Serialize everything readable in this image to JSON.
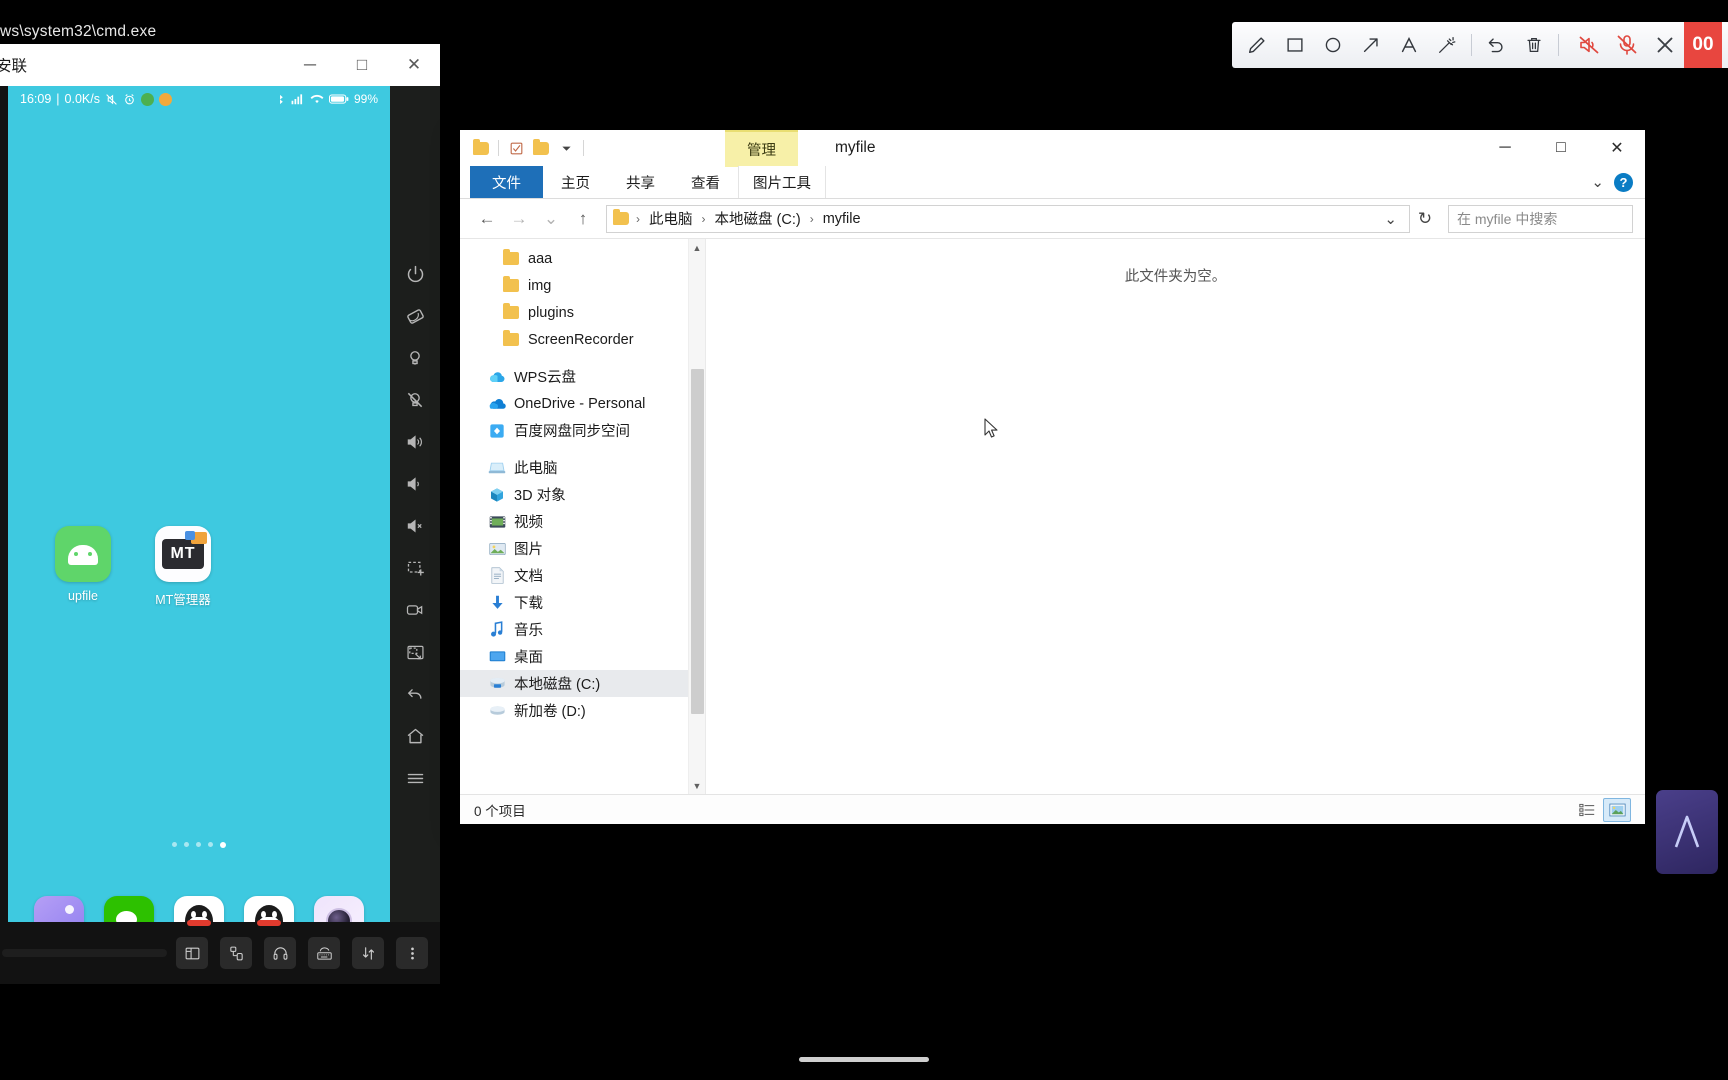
{
  "annotation_toolbar": {
    "tools": [
      {
        "name": "pencil-icon",
        "label": "铅笔"
      },
      {
        "name": "rectangle-icon",
        "label": "矩形"
      },
      {
        "name": "ellipse-icon",
        "label": "椭圆"
      },
      {
        "name": "arrow-icon",
        "label": "箭头"
      },
      {
        "name": "text-icon",
        "label": "A"
      },
      {
        "name": "magic-wand-icon",
        "label": "魔术棒"
      }
    ],
    "actions": [
      {
        "name": "undo-icon",
        "label": "撤销"
      },
      {
        "name": "delete-icon",
        "label": "删除"
      }
    ],
    "right_actions": [
      {
        "name": "speaker-muted-icon",
        "label": "静音"
      },
      {
        "name": "mic-muted-icon",
        "label": "麦克风静音"
      },
      {
        "name": "close-icon",
        "label": "关闭"
      }
    ],
    "record_badge": "00",
    "accent_red": "#e8463f"
  },
  "cmd_window": {
    "title": "ws\\system32\\cmd.exe"
  },
  "mirror_window": {
    "title": "安联",
    "window_buttons": [
      {
        "name": "minimize-button",
        "glyph": "─"
      },
      {
        "name": "maximize-button",
        "glyph": "□"
      },
      {
        "name": "close-button",
        "glyph": "✕"
      }
    ],
    "status_bar": {
      "time": "16:09",
      "network_speed": "0.0K/s",
      "battery": "99%"
    },
    "apps": [
      {
        "name": "upfile",
        "label": "upfile"
      },
      {
        "name": "mt-manager",
        "label": "MT管理器"
      }
    ],
    "dock": [
      {
        "name": "gallery-app",
        "label": "图库"
      },
      {
        "name": "wechat-app",
        "label": "微信"
      },
      {
        "name": "qq-app",
        "label": "QQ"
      },
      {
        "name": "qq-app-2",
        "label": "QQ"
      },
      {
        "name": "camera-app",
        "label": "相机"
      }
    ],
    "page_dots": 5,
    "active_dot": 5,
    "side_toolbar": [
      {
        "name": "power-icon",
        "label": "电源"
      },
      {
        "name": "rotate-screen-icon",
        "label": "旋转屏幕"
      },
      {
        "name": "light-on-icon",
        "label": "亮屏"
      },
      {
        "name": "light-off-icon",
        "label": "熄屏"
      },
      {
        "name": "volume-up-icon",
        "label": "音量加"
      },
      {
        "name": "volume-down-icon",
        "label": "音量减"
      },
      {
        "name": "volume-mute-icon",
        "label": "静音"
      },
      {
        "name": "screenshot-icon",
        "label": "截图"
      },
      {
        "name": "record-video-icon",
        "label": "录屏"
      },
      {
        "name": "region-capture-icon",
        "label": "区域截图"
      },
      {
        "name": "back-icon",
        "label": "返回"
      },
      {
        "name": "home-icon",
        "label": "主页"
      },
      {
        "name": "menu-icon",
        "label": "菜单"
      }
    ],
    "bottom_toolbar": [
      {
        "name": "layout-icon",
        "label": "布局"
      },
      {
        "name": "usb-device-icon",
        "label": "设备"
      },
      {
        "name": "audio-icon",
        "label": "音频"
      },
      {
        "name": "keyboard-icon",
        "label": "键盘"
      },
      {
        "name": "transfer-icon",
        "label": "传输"
      },
      {
        "name": "more-icon",
        "label": "更多"
      }
    ]
  },
  "explorer": {
    "title": "myfile",
    "quick_access": [
      {
        "name": "folder-icon",
        "label": "文件夹"
      },
      {
        "name": "checkbox-icon",
        "label": "属性"
      },
      {
        "name": "new-folder-icon",
        "label": "新建文件夹"
      },
      {
        "name": "chevron-down-icon",
        "label": "▾"
      }
    ],
    "contextual_tab_group": "管理",
    "window_buttons": [
      {
        "name": "minimize-button",
        "glyph": "─"
      },
      {
        "name": "maximize-button",
        "glyph": "□"
      },
      {
        "name": "close-button",
        "glyph": "✕"
      }
    ],
    "tabs": [
      {
        "name": "tab-file",
        "label": "文件"
      },
      {
        "name": "tab-home",
        "label": "主页"
      },
      {
        "name": "tab-share",
        "label": "共享"
      },
      {
        "name": "tab-view",
        "label": "查看"
      },
      {
        "name": "tab-picture-tools",
        "label": "图片工具"
      }
    ],
    "ribbon_expand": "⌄",
    "help_label": "?",
    "nav": {
      "back": "←",
      "forward": "→",
      "recent": "⌄",
      "up": "↑"
    },
    "breadcrumb": [
      "此电脑",
      "本地磁盘 (C:)",
      "myfile"
    ],
    "breadcrumb_separator": "›",
    "address_dropdown": "⌄",
    "refresh": "↻",
    "search": {
      "placeholder": "在 myfile 中搜索",
      "value": "",
      "icon": "search-icon"
    },
    "sidebar": [
      {
        "label": "aaa",
        "icon": "folder-icon",
        "level": 3,
        "selected": false
      },
      {
        "label": "img",
        "icon": "folder-icon",
        "level": 3,
        "selected": false
      },
      {
        "label": "plugins",
        "icon": "folder-icon",
        "level": 3,
        "selected": false
      },
      {
        "label": "ScreenRecorder",
        "icon": "folder-icon",
        "level": 3,
        "selected": false
      },
      {
        "label": "WPS云盘",
        "icon": "cloud-blue-icon",
        "level": 0,
        "selected": false
      },
      {
        "label": "OneDrive - Personal",
        "icon": "onedrive-icon",
        "level": 0,
        "selected": false
      },
      {
        "label": "百度网盘同步空间",
        "icon": "baidu-netdisk-icon",
        "level": 0,
        "selected": false
      },
      {
        "label": "此电脑",
        "icon": "this-pc-icon",
        "level": 0,
        "selected": false
      },
      {
        "label": "3D 对象",
        "icon": "3d-objects-icon",
        "level": 1,
        "selected": false
      },
      {
        "label": "视频",
        "icon": "videos-icon",
        "level": 1,
        "selected": false
      },
      {
        "label": "图片",
        "icon": "pictures-icon",
        "level": 1,
        "selected": false
      },
      {
        "label": "文档",
        "icon": "documents-icon",
        "level": 1,
        "selected": false
      },
      {
        "label": "下载",
        "icon": "downloads-icon",
        "level": 1,
        "selected": false
      },
      {
        "label": "音乐",
        "icon": "music-icon",
        "level": 1,
        "selected": false
      },
      {
        "label": "桌面",
        "icon": "desktop-icon",
        "level": 1,
        "selected": false
      },
      {
        "label": "本地磁盘 (C:)",
        "icon": "local-disk-icon",
        "level": 1,
        "selected": true
      },
      {
        "label": "新加卷 (D:)",
        "icon": "volume-icon",
        "level": 1,
        "selected": false
      }
    ],
    "content": {
      "empty_message": "此文件夹为空。"
    },
    "status": {
      "item_count": "0 个项目"
    },
    "view_buttons": [
      {
        "name": "details-view-button",
        "label": "详细信息",
        "active": false
      },
      {
        "name": "large-icons-view-button",
        "label": "大图标",
        "active": true
      }
    ]
  }
}
